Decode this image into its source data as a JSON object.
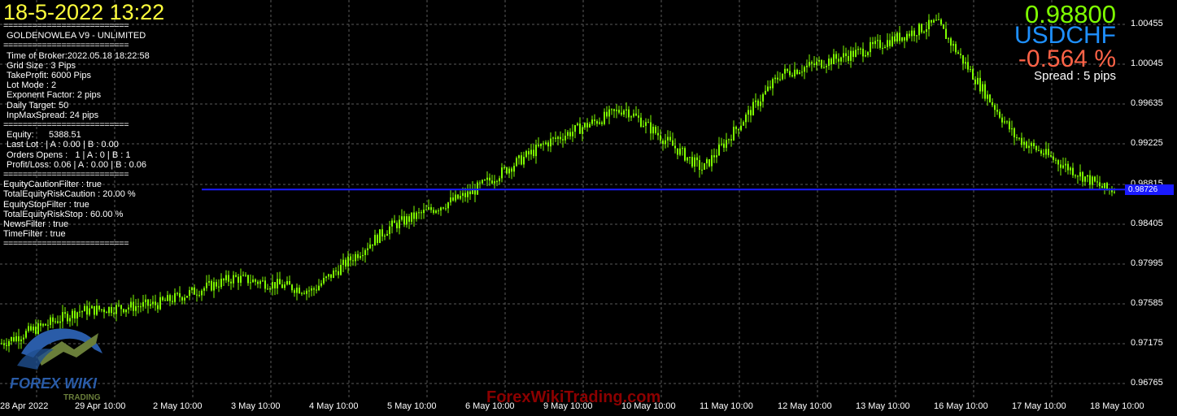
{
  "header": {
    "datetime": "18-5-2022 13:22",
    "bid_price": "0.98800",
    "symbol": "USDCHF",
    "change": "-0.564 %",
    "spread": "Spread : 5 pips"
  },
  "info_panel": {
    "separator": "==========================",
    "ea_name": "GOLDENOWLEA V9 - UNLIMITED",
    "settings": [
      "Time of Broker:2022.05.18 18:22:58",
      "Grid Size : 3 Pips",
      "TakeProfit: 6000 Pips",
      "Lot Mode : 2",
      "Exponent Factor: 2 pips",
      "Daily Target: 50",
      "InpMaxSpread: 24 pips"
    ],
    "account": [
      "Equity:      5388.51",
      "Last Lot : | A : 0.00 | B : 0.00",
      "Orders Opens :   1 | A : 0 | B : 1",
      "Profit/Loss: 0.06 | A : 0.00 | B : 0.06"
    ],
    "filters": [
      "EquityCautionFilter : true",
      "TotalEquityRiskCaution : 20.00 %",
      "EquityStopFilter : true",
      "TotalEquityRiskStop : 60.00 %",
      "NewsFilter : true",
      "TimeFilter : true"
    ]
  },
  "price_axis": [
    "1.00455",
    "1.00045",
    "0.99635",
    "0.99225",
    "0.98815",
    "0.98405",
    "0.97995",
    "0.97585",
    "0.97175",
    "0.96765"
  ],
  "time_axis": [
    "28 Apr 2022",
    "29 Apr 10:00",
    "2 May 10:00",
    "3 May 10:00",
    "4 May 10:00",
    "5 May 10:00",
    "6 May 10:00",
    "9 May 10:00",
    "10 May 10:00",
    "11 May 10:00",
    "12 May 10:00",
    "13 May 10:00",
    "16 May 10:00",
    "17 May 10:00",
    "18 May 10:00"
  ],
  "current_price_tag": "0.98726",
  "logo": {
    "text": "FOREX WIKI",
    "sub": "TRADING"
  },
  "watermark": "ForexWikiTrading.com",
  "colors": {
    "candle": "#7fff00",
    "grid": "#5a5a5a",
    "price_line": "#1a1aff"
  },
  "chart_data": {
    "type": "line",
    "x": [
      "28 Apr",
      "29 Apr",
      "2 May",
      "3 May",
      "4 May",
      "5 May",
      "6 May",
      "9 May",
      "10 May",
      "11 May",
      "12 May",
      "13 May",
      "16 May",
      "17 May",
      "18 May"
    ],
    "series": [
      {
        "values": [
          0.9716,
          0.9749,
          0.9756,
          0.9783,
          0.977,
          0.9835,
          0.9868,
          0.992,
          0.9955,
          0.9893,
          0.999,
          1.0012,
          1.0042,
          0.9926,
          0.988
        ]
      }
    ],
    "ylim": [
      0.966,
      1.0065
    ],
    "current_price": 0.98726
  }
}
